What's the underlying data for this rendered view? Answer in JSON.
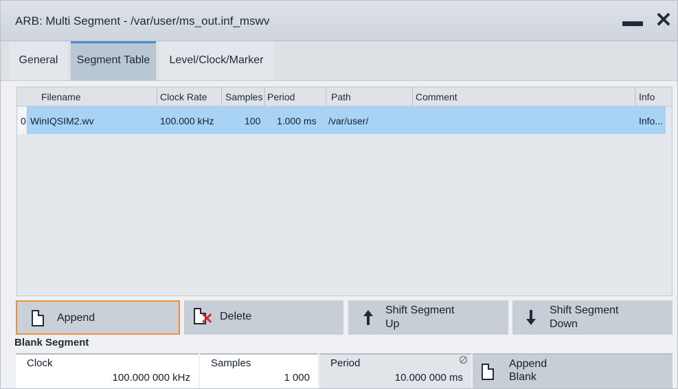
{
  "window": {
    "title": "ARB: Multi Segment - /var/user/ms_out.inf_mswv",
    "minimize_icon": "minimize-icon",
    "close_icon": "close-icon"
  },
  "tabs": [
    {
      "label": "General",
      "active": false
    },
    {
      "label": "Segment Table",
      "active": true
    },
    {
      "label": "Level/Clock/Marker",
      "active": false
    }
  ],
  "table": {
    "columns": [
      "Filename",
      "Clock Rate",
      "Samples",
      "Period",
      "Path",
      "Comment",
      "Info"
    ],
    "rows": [
      {
        "index": "0",
        "filename": "WinIQSIM2.wv",
        "clock_rate": "100.000  kHz",
        "samples": "100",
        "period": "1.000  ms",
        "path": "/var/user/",
        "comment": "",
        "info": "Info..."
      }
    ],
    "selected_row_color": "#a8d3f5"
  },
  "buttons": {
    "append": "Append",
    "delete": "Delete",
    "shift_up_line1": "Shift Segment",
    "shift_up_line2": "Up",
    "shift_down_line1": "Shift Segment",
    "shift_down_line2": "Down",
    "append_focus_color": "#ef8e32"
  },
  "blank_segment": {
    "title": "Blank Segment",
    "clock_label": "Clock",
    "clock_value": "100.000 000 kHz",
    "samples_label": "Samples",
    "samples_value": "1 000",
    "period_label": "Period",
    "period_value": "10.000 000 ms",
    "append_blank_line1": "Append",
    "append_blank_line2": "Blank"
  }
}
